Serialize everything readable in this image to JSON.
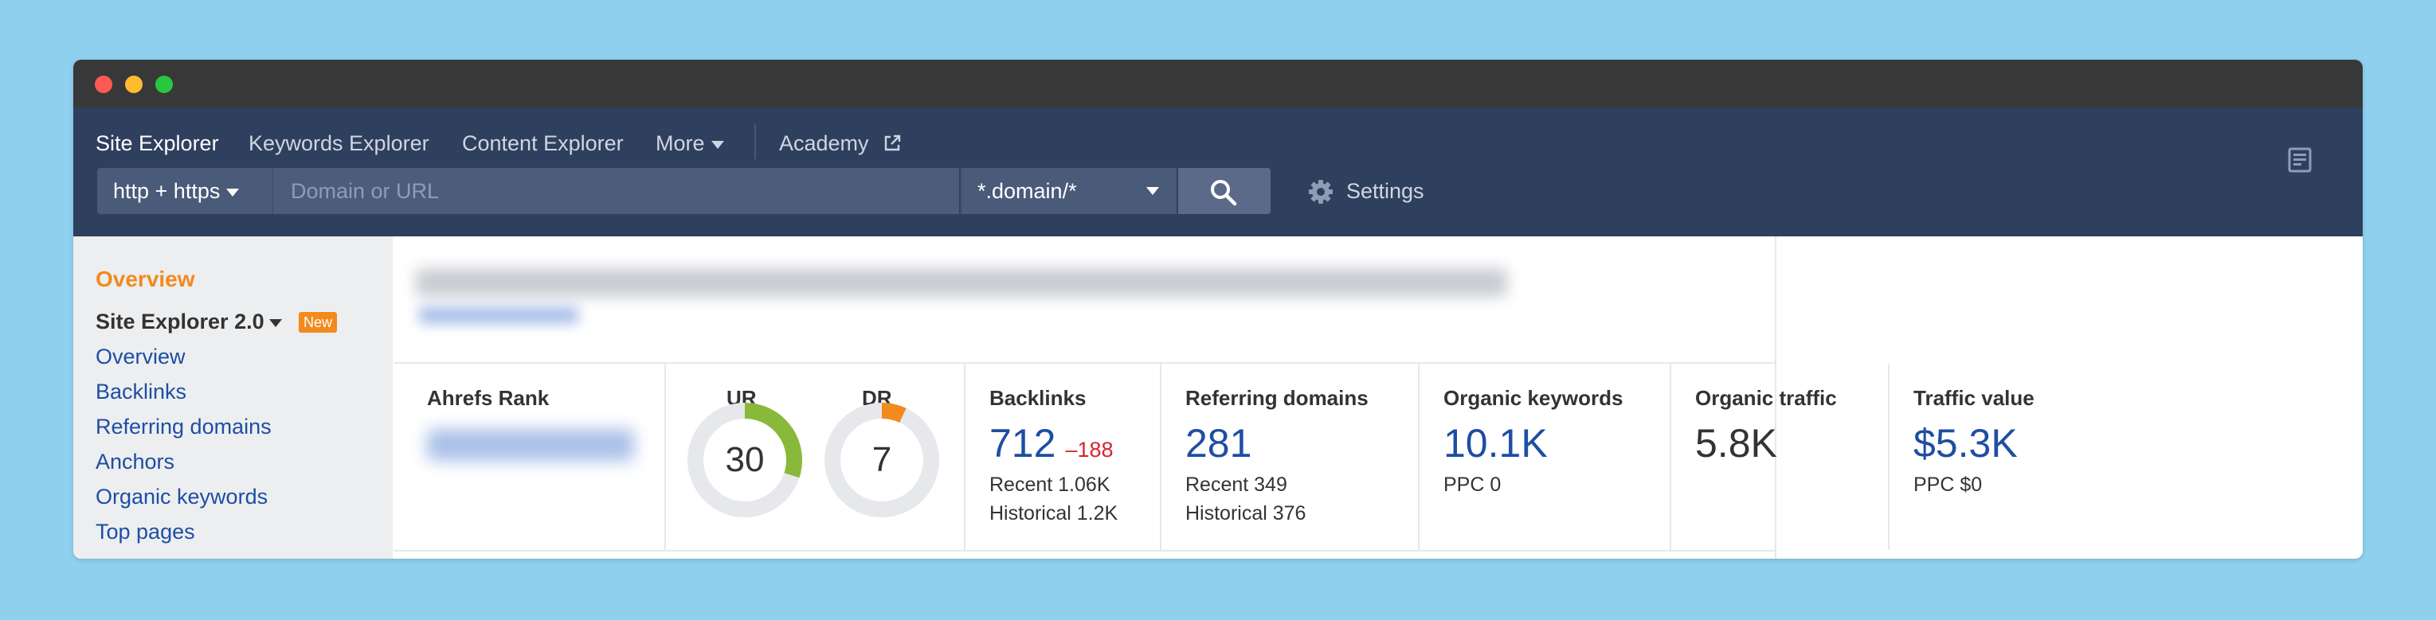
{
  "nav": {
    "items": [
      "Site Explorer",
      "Keywords Explorer",
      "Content Explorer",
      "More",
      "Academy"
    ]
  },
  "search": {
    "protocol": "http + https",
    "placeholder": "Domain or URL",
    "mode": "*.domain/*",
    "settings_label": "Settings"
  },
  "sidebar": {
    "overview": "Overview",
    "section_title": "Site Explorer 2.0",
    "badge": "New",
    "links": [
      "Overview",
      "Backlinks",
      "Referring domains",
      "Anchors",
      "Organic keywords",
      "Top pages"
    ]
  },
  "metrics": {
    "ahrefs_rank_label": "Ahrefs Rank",
    "ur": {
      "label": "UR",
      "value": "30",
      "level": 30,
      "color": "#8ab83a"
    },
    "dr": {
      "label": "DR",
      "value": "7",
      "level": 7,
      "color": "#f28a1e"
    },
    "backlinks": {
      "label": "Backlinks",
      "value": "712",
      "delta": "–188",
      "recent": "Recent 1.06K",
      "historical": "Historical 1.2K"
    },
    "referring_domains": {
      "label": "Referring domains",
      "value": "281",
      "recent": "Recent 349",
      "historical": "Historical 376"
    },
    "organic_keywords": {
      "label": "Organic keywords",
      "value": "10.1K",
      "ppc": "PPC 0"
    },
    "organic_traffic": {
      "label": "Organic traffic",
      "value": "5.8K"
    },
    "traffic_value": {
      "label": "Traffic value",
      "value": "$5.3K",
      "ppc": "PPC $0"
    }
  },
  "colors": {
    "accent": "#f28a1e",
    "link": "#1d4ea3",
    "appbar": "#2f3f5e",
    "negative": "#d8252d"
  }
}
